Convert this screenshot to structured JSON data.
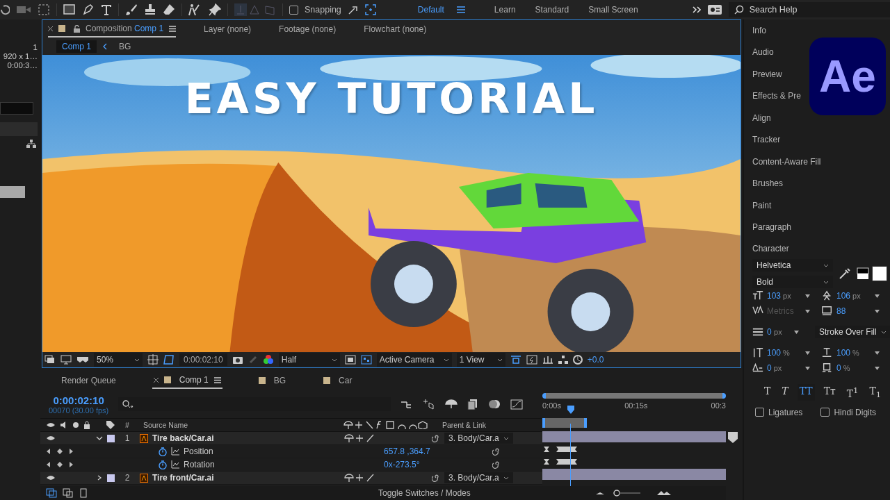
{
  "toolbar": {
    "snapping": {
      "label": "Snapping",
      "checked": false
    },
    "workspaces": [
      {
        "label": "Default",
        "selected": true
      },
      {
        "label": "Learn",
        "selected": false
      },
      {
        "label": "Standard",
        "selected": false
      },
      {
        "label": "Small Screen",
        "selected": false
      }
    ],
    "search": {
      "placeholder": "Search Help"
    }
  },
  "left_panel": {
    "lines": [
      "1",
      "920 x 1…",
      "0:00:3…"
    ]
  },
  "composition": {
    "tabs": [
      {
        "label": "Composition",
        "name": "Comp 1",
        "selected": true
      },
      {
        "label": "Layer (none)",
        "selected": false
      },
      {
        "label": "Footage (none)",
        "selected": false
      },
      {
        "label": "Flowchart (none)",
        "selected": false
      }
    ],
    "breadcrumb": [
      {
        "label": "Comp 1",
        "selected": true
      },
      {
        "label": "BG",
        "selected": false
      }
    ],
    "title_text": "EASY TUTORIAL",
    "viewer_bar": {
      "zoom": "50%",
      "timecode": "0:00:02:10",
      "resolution": "Half",
      "camera": "Active Camera",
      "views": "1 View",
      "exposure": "+0.0"
    }
  },
  "panels": [
    "Info",
    "Audio",
    "Preview",
    "Effects & Pre",
    "Align",
    "Tracker",
    "Content-Aware Fill",
    "Brushes",
    "Paint",
    "Paragraph"
  ],
  "logo": "Ae",
  "character": {
    "title": "Character",
    "font": "Helvetica",
    "style": "Bold",
    "size": "103",
    "size_unit": "px",
    "leading": "106",
    "leading_unit": "px",
    "kerning": "Metrics",
    "tracking": "88",
    "stroke": "0",
    "stroke_unit": "px",
    "stroke_mode": "Stroke Over Fill",
    "vscale": "100",
    "vscale_unit": "%",
    "hscale": "100",
    "hscale_unit": "%",
    "baseline": "0",
    "baseline_unit": "px",
    "tsume": "0",
    "tsume_unit": "%",
    "styles": [
      {
        "label": "T",
        "selected": false
      },
      {
        "label": "*T*",
        "selected": false
      },
      {
        "label": "TT",
        "selected": true
      },
      {
        "label": "Tᴛ",
        "selected": false
      },
      {
        "label": "T$^{1}$",
        "selected": false
      },
      {
        "label": "T$_{1}$",
        "selected": false
      }
    ],
    "options": [
      {
        "label": "Ligatures",
        "checked": false
      },
      {
        "label": "Hindi Digits",
        "checked": false
      }
    ]
  },
  "timeline": {
    "tabs": [
      {
        "label": "Render Queue",
        "selected": false
      },
      {
        "label": "Comp 1",
        "selected": true,
        "color": "#c8b48c"
      },
      {
        "label": "BG",
        "selected": false,
        "color": "#c8b48c"
      },
      {
        "label": "Car",
        "selected": false,
        "color": "#c8b48c"
      }
    ],
    "timecode": "0:00:02:10",
    "frames": "00070 (30.00 fps)",
    "columns": {
      "hash": "#",
      "source": "Source Name",
      "parent": "Parent & Link"
    },
    "ruler": [
      "0:00s",
      "00:15s",
      "00:3"
    ],
    "layers": [
      {
        "number": "1",
        "name": "Tire back/Car.ai",
        "parent": "3. Body/Car.a",
        "expanded": true,
        "color": "#c8c8ee",
        "properties": [
          {
            "name": "Position",
            "value": "657.8 ,364.7"
          },
          {
            "name": "Rotation",
            "value": "0x-273.5°"
          }
        ]
      },
      {
        "number": "2",
        "name": "Tire front/Car.ai",
        "parent": "3. Body/Car.a",
        "expanded": false,
        "color": "#c8c8ee"
      }
    ],
    "toggle": "Toggle Switches / Modes"
  }
}
